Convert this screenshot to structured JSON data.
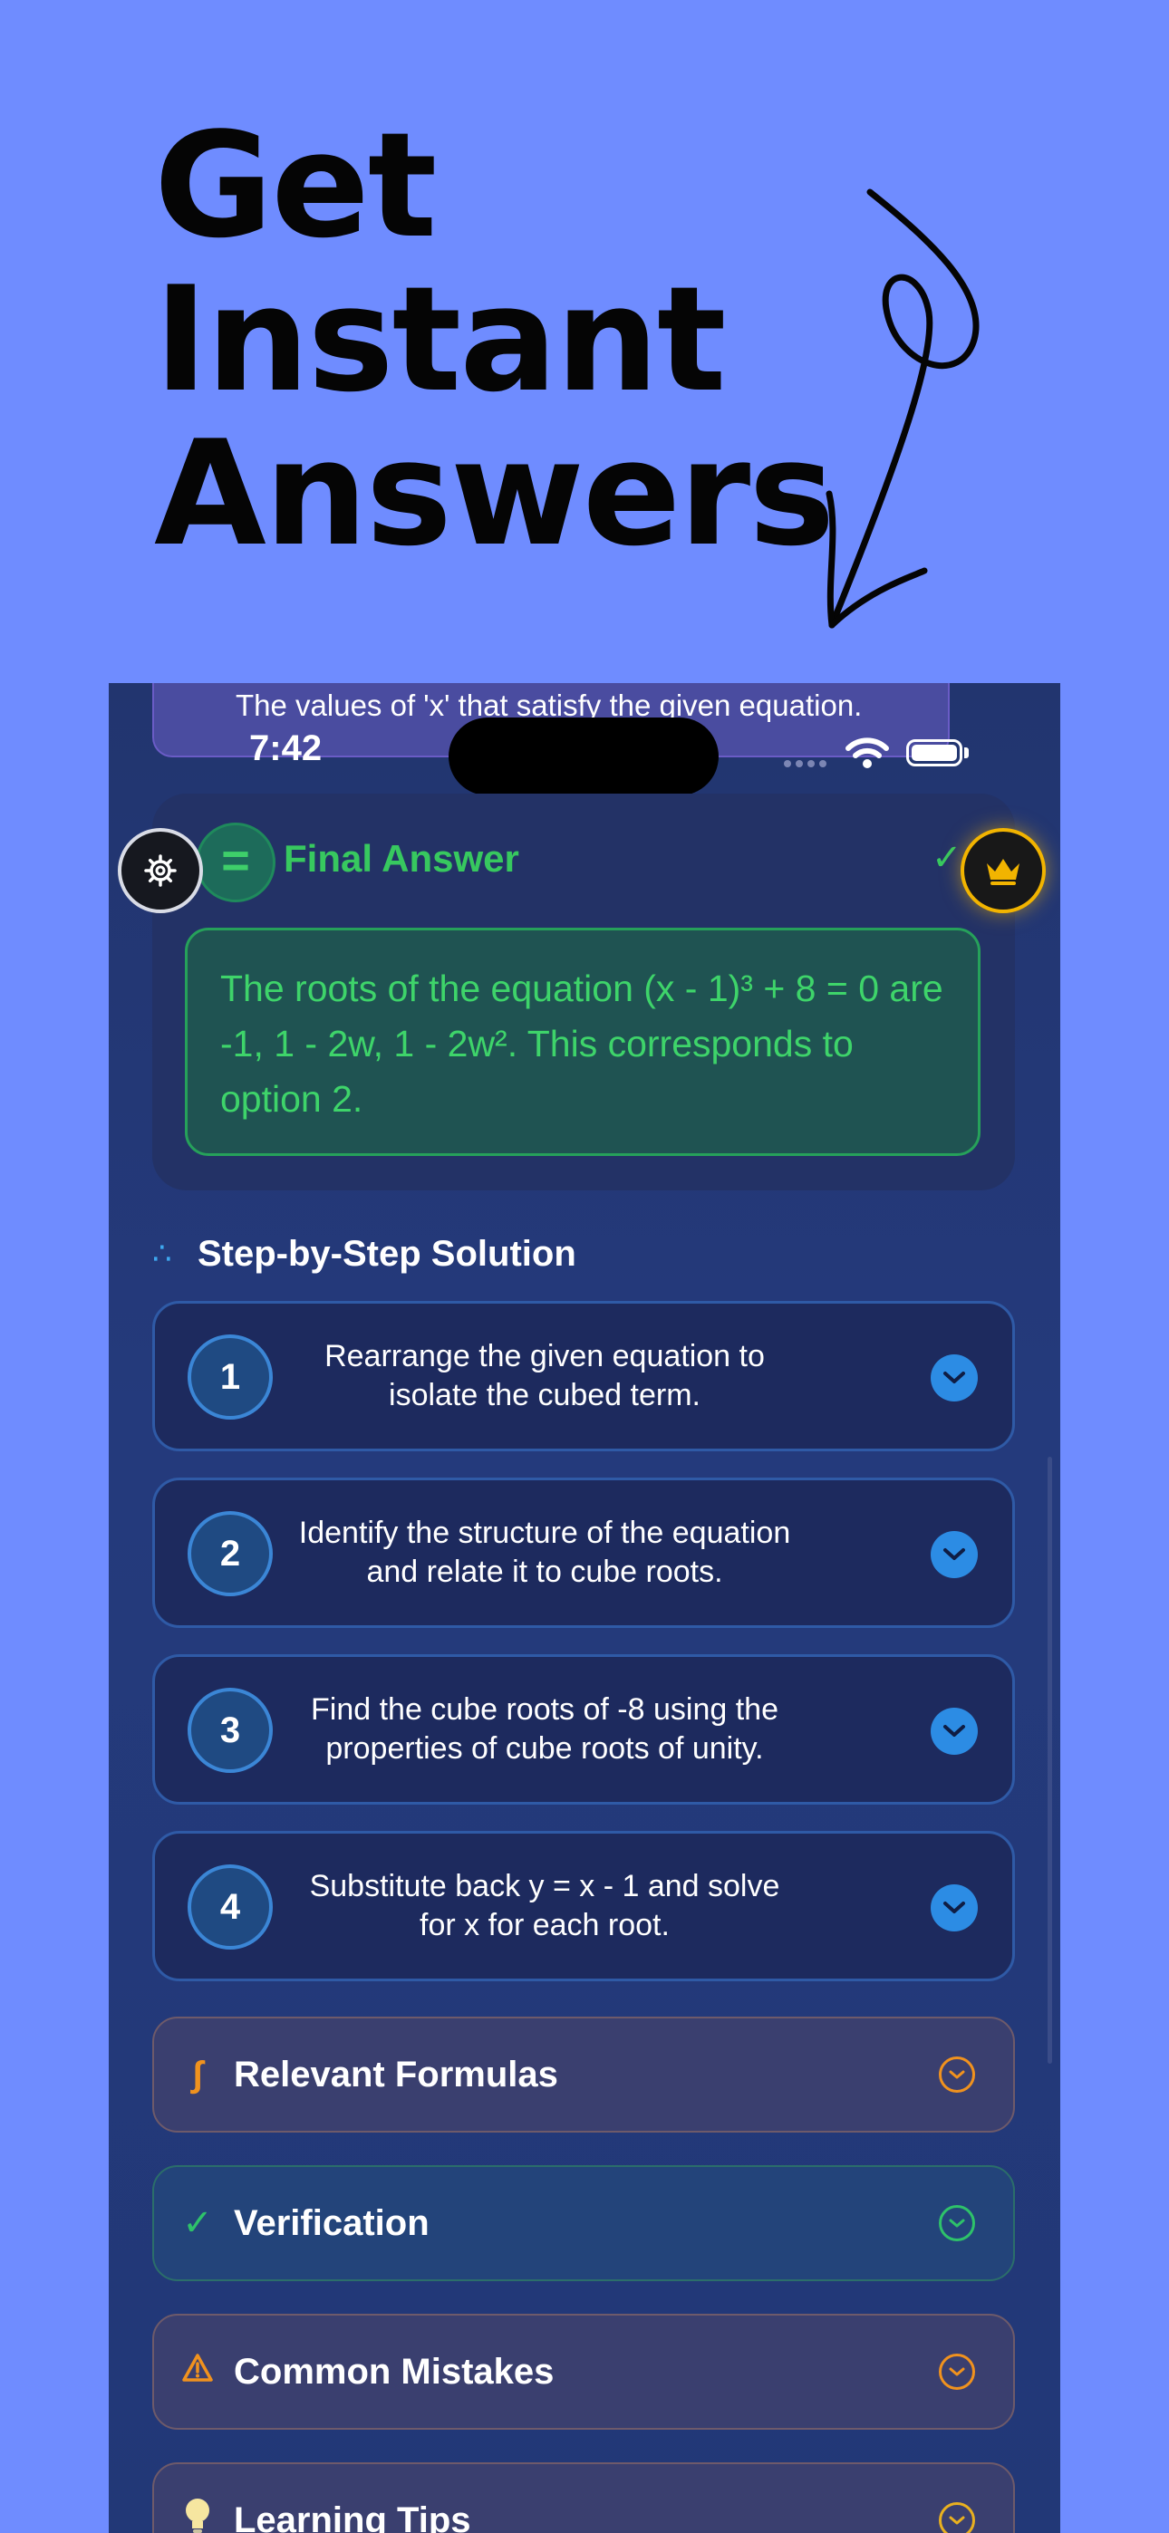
{
  "headline": {
    "line1": "Get",
    "line2": "Instant",
    "line3": "Answers"
  },
  "prev_card": {
    "text": "The values of 'x' that satisfy the given equation."
  },
  "status_bar": {
    "time": "7:42"
  },
  "final_answer": {
    "badge": "=",
    "title": "Final Answer",
    "check": "✓",
    "text": "The roots of the equation (x - 1)³ + 8 = 0 are -1, 1 - 2w, 1 - 2w². This corresponds to option 2."
  },
  "solution": {
    "icon": "∴",
    "title": "Step-by-Step Solution",
    "steps": [
      {
        "num": "1",
        "text": "Rearrange the given equation to isolate the cubed term."
      },
      {
        "num": "2",
        "text": "Identify the structure of the equation and relate it to cube roots."
      },
      {
        "num": "3",
        "text": "Find the cube roots of -8 using the properties of cube roots of unity."
      },
      {
        "num": "4",
        "text": "Substitute back y = x - 1 and solve for x for each root."
      }
    ]
  },
  "sections": {
    "formulas": {
      "icon": "∫",
      "title": "Relevant Formulas"
    },
    "verification": {
      "icon": "✓",
      "title": "Verification"
    },
    "mistakes": {
      "title": "Common Mistakes"
    },
    "tips": {
      "title": "Learning Tips"
    }
  },
  "icons": {
    "settings": "gear-icon",
    "crown": "crown-icon",
    "wifi": "wifi-icon",
    "battery": "battery-icon",
    "warning": "warning-icon",
    "bulb": "lightbulb-icon",
    "chevron": "chevron-down-icon"
  },
  "colors": {
    "background": "#6f8cff",
    "phone_bg": "#243a7c",
    "answer_green": "#3ed46a",
    "step_accent": "#2c8ce4",
    "formulas_orange": "#f0921e",
    "verify_green": "#2ec26a",
    "crown_gold": "#f2b400"
  }
}
